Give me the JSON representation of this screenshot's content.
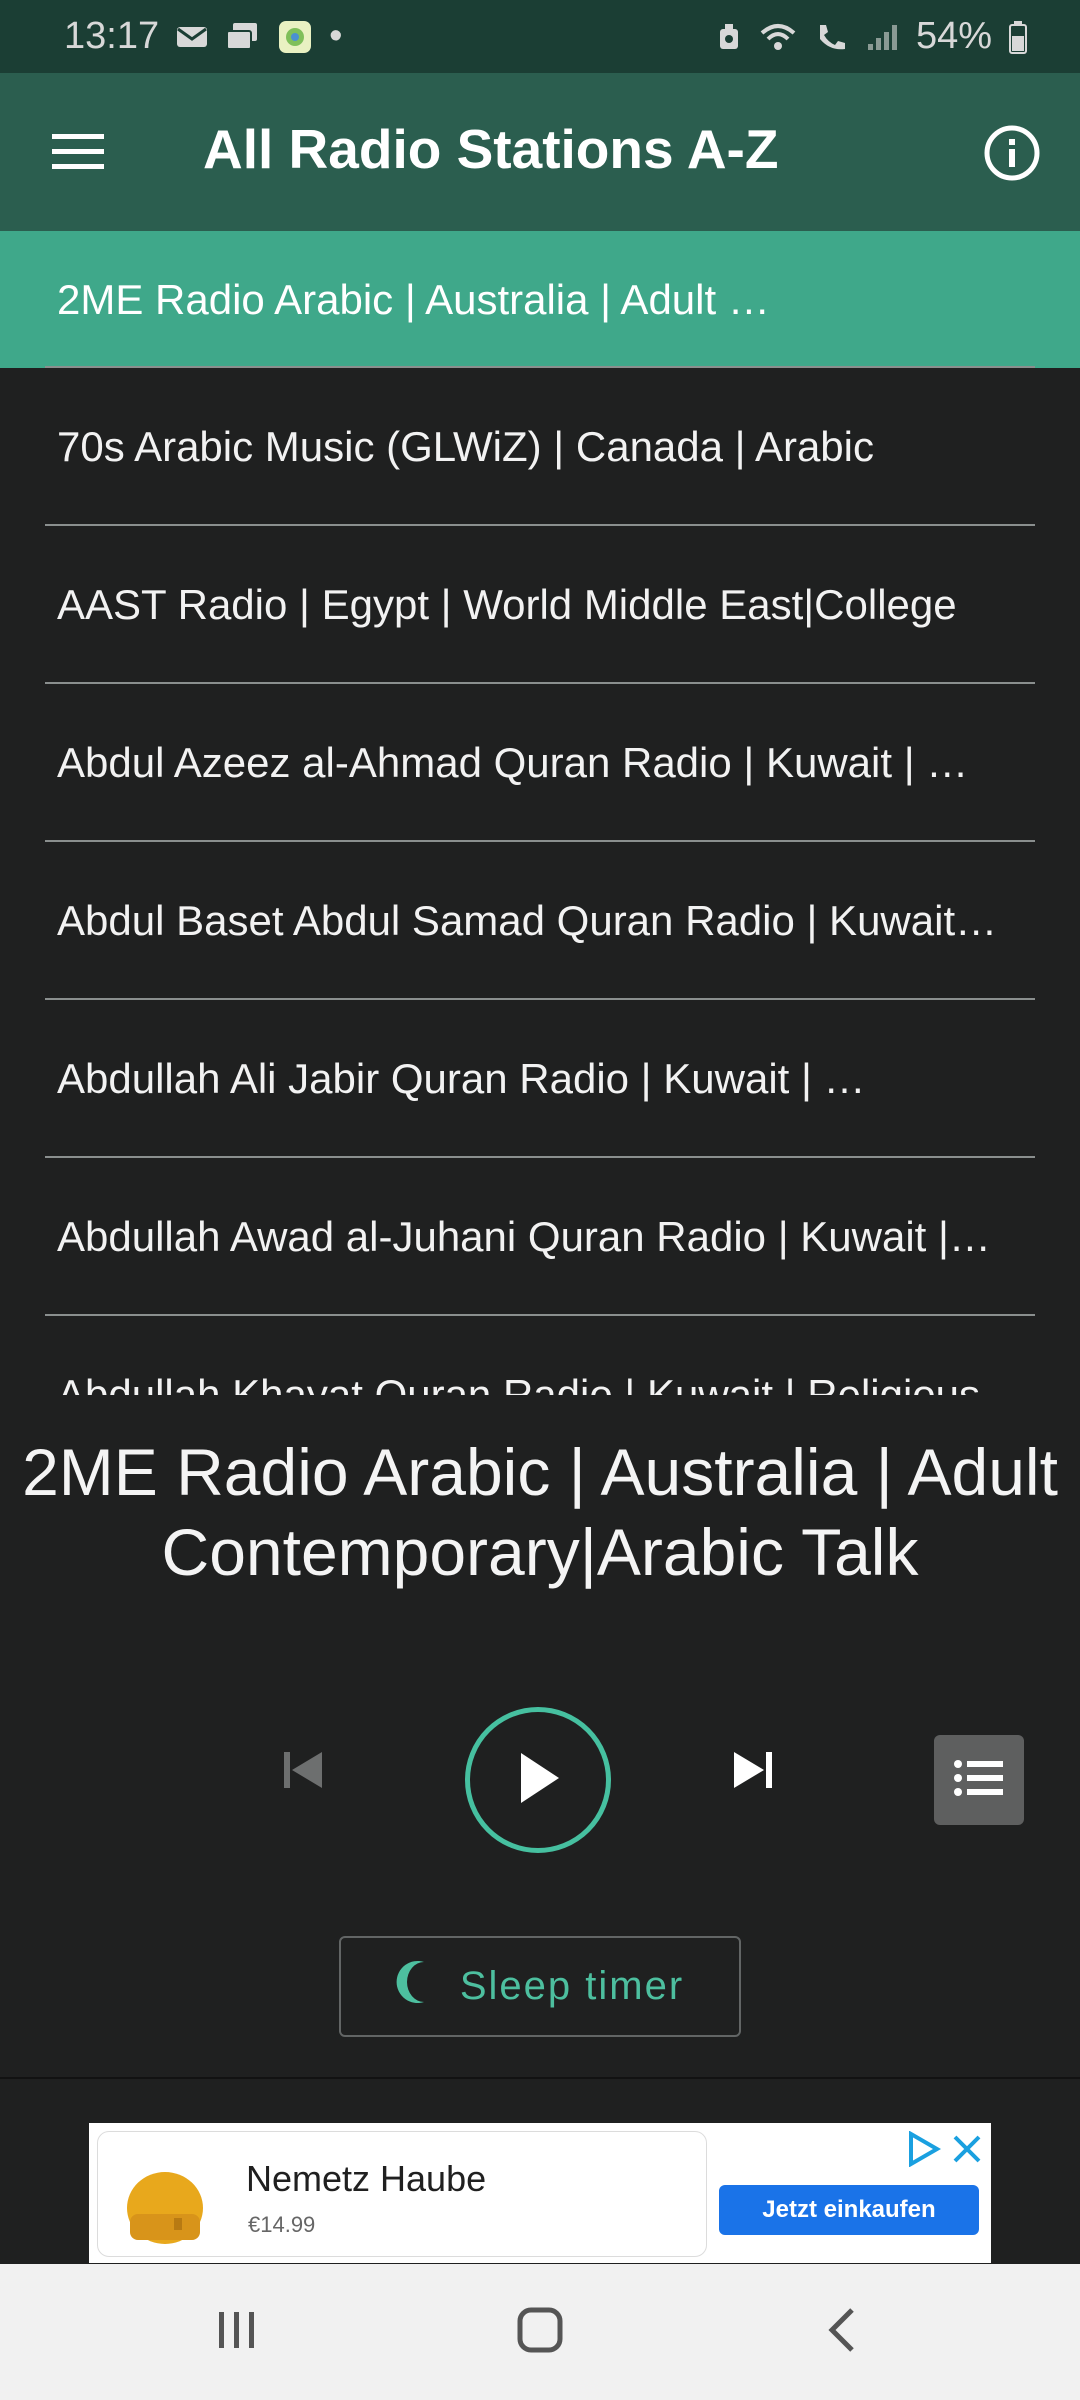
{
  "status_bar": {
    "time": "13:17",
    "dot": "•",
    "battery": "54%"
  },
  "app_bar": {
    "title": "All Radio Stations A-Z"
  },
  "stations": [
    {
      "label": "2ME Radio Arabic | Australia | Adult …"
    },
    {
      "label": "70s Arabic Music (GLWiZ) | Canada | Arabic"
    },
    {
      "label": "AAST Radio | Egypt | World Middle East|College"
    },
    {
      "label": "Abdul Azeez al-Ahmad Quran Radio | Kuwait | …"
    },
    {
      "label": "Abdul Baset Abdul Samad Quran Radio | Kuwait…"
    },
    {
      "label": "Abdullah Ali Jabir Quran Radio | Kuwait | …"
    },
    {
      "label": "Abdullah Awad al-Juhani Quran Radio | Kuwait |…"
    },
    {
      "label": "Abdullah Khayat Quran Radio | Kuwait | Religious"
    }
  ],
  "now_playing": {
    "line1": "2ME Radio Arabic | Australia | Adult",
    "line2": "Contemporary|Arabic Talk"
  },
  "sleep_timer": {
    "label": "Sleep timer"
  },
  "ad": {
    "title": "Nemetz Haube",
    "price": "€14.99",
    "cta": "Jetzt einkaufen"
  },
  "colors": {
    "accent": "#3fa88a",
    "app_bar": "#2b5e4f",
    "status_bar": "#1b3e34",
    "background": "#1f2020"
  }
}
